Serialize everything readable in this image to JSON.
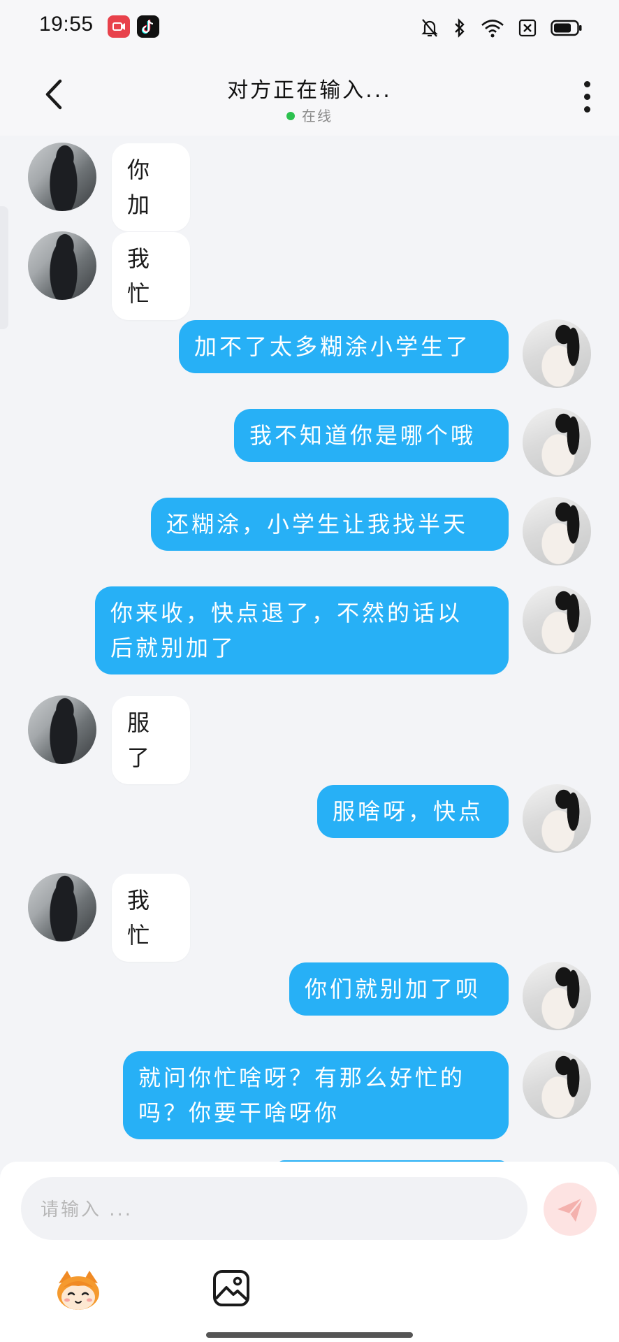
{
  "status_bar": {
    "time": "19:55"
  },
  "header": {
    "title": "对方正在输入...",
    "status": "在线"
  },
  "messages": [
    {
      "side": "in",
      "lines": [
        "你加"
      ]
    },
    {
      "side": "in",
      "lines": [
        "我忙"
      ]
    },
    {
      "side": "out",
      "lines": [
        "加不了太多糊涂小学生了"
      ]
    },
    {
      "side": "out",
      "lines": [
        "我不知道你是哪个哦"
      ]
    },
    {
      "side": "out",
      "lines": [
        "还糊涂，小学生让我找半天"
      ]
    },
    {
      "side": "out",
      "lines": [
        "你来收，快点退了，不然的话以",
        "后就别加了"
      ]
    },
    {
      "side": "in",
      "lines": [
        "服了"
      ]
    },
    {
      "side": "out",
      "lines": [
        "服啥呀，快点"
      ]
    },
    {
      "side": "in",
      "lines": [
        "我忙"
      ]
    },
    {
      "side": "out",
      "lines": [
        "你们就别加了呗"
      ]
    },
    {
      "side": "out",
      "lines": [
        "就问你忙啥呀？有那么好忙的",
        "吗？你要干啥呀你"
      ]
    }
  ],
  "input": {
    "placeholder": "请输入 ..."
  },
  "colors": {
    "outgoing_bubble": "#27b0f6",
    "incoming_bubble": "#ffffff",
    "online": "#2cc14f",
    "send_button": "#fde3e2"
  },
  "icons": [
    "back-icon",
    "more-icon",
    "send-icon",
    "emoji-mascot-icon",
    "image-icon"
  ]
}
